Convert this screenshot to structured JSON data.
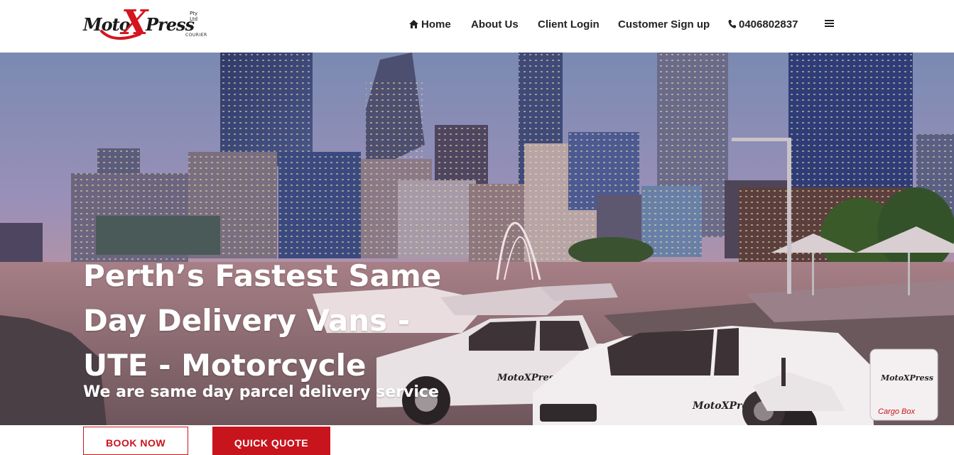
{
  "brand": {
    "logo_moto": "Moto",
    "logo_x": "X",
    "logo_press": "Press",
    "logo_ptyltd": "Pty Ltd",
    "logo_courier": "COURIER",
    "accent_color": "#c8141c"
  },
  "nav": {
    "home": {
      "label": "Home",
      "icon": "home-icon"
    },
    "about": {
      "label": "About Us"
    },
    "client_login": {
      "label": "Client Login"
    },
    "signup": {
      "label": "Customer Sign up"
    },
    "phone": {
      "label": "0406802837",
      "icon": "phone-icon"
    },
    "menu": {
      "icon": "hamburger-menu-icon"
    }
  },
  "hero": {
    "title_lines": [
      "Perth’s Fastest Same",
      "Day Delivery Vans -",
      "UTE - Motorcycle"
    ],
    "subtitle": "We are same day parcel delivery service",
    "cargo_box_label": "Cargo Box",
    "vehicle_logo": "MotoXPress"
  },
  "buttons": {
    "book_now": "BOOK NOW",
    "quick_quote": "QUICK QUOTE"
  }
}
